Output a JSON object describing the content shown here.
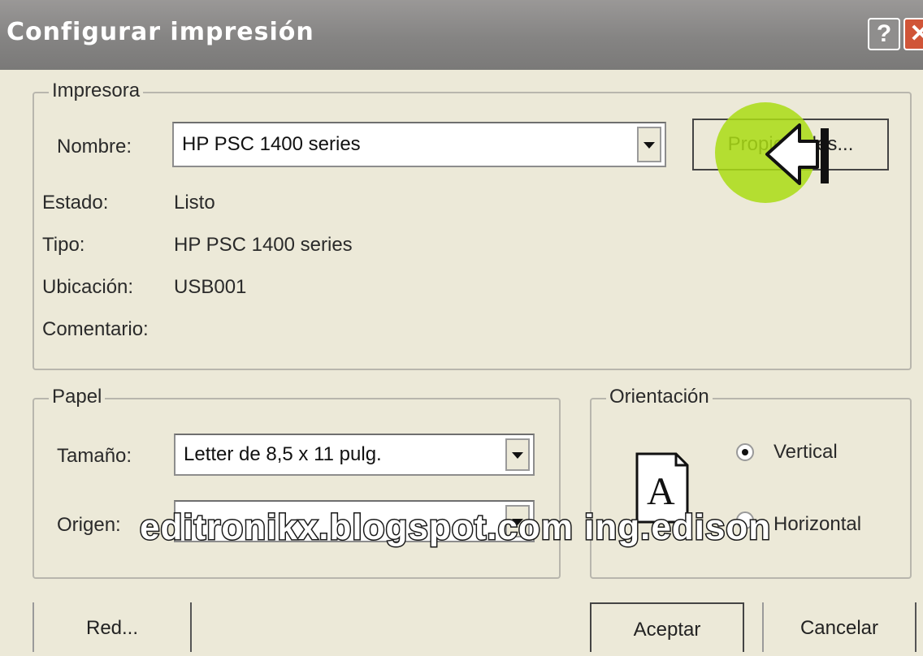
{
  "window": {
    "title": "Configurar impresión",
    "help_glyph": "?",
    "close_glyph": "✕"
  },
  "printer": {
    "group_label": "Impresora",
    "name_label": "Nombre:",
    "name_value": "HP PSC 1400 series",
    "properties_label": "Propiedades...",
    "status_label": "Estado:",
    "status_value": "Listo",
    "type_label": "Tipo:",
    "type_value": "HP PSC 1400 series",
    "location_label": "Ubicación:",
    "location_value": "USB001",
    "comment_label": "Comentario:",
    "comment_value": ""
  },
  "paper": {
    "group_label": "Papel",
    "size_label": "Tamaño:",
    "size_value": "Letter de 8,5 x 11 pulg.",
    "source_label": "Origen:",
    "source_value": ""
  },
  "orientation": {
    "group_label": "Orientación",
    "page_icon_letter": "A",
    "options": [
      {
        "label": "Vertical",
        "selected": true
      },
      {
        "label": "Horizontal",
        "selected": false
      }
    ]
  },
  "footer": {
    "network_label": "Red...",
    "ok_label": "Aceptar",
    "cancel_label": "Cancelar"
  },
  "overlay": {
    "watermark": "editronikx.blogspot.com ing.edison",
    "highlight_color": "#aadc14"
  }
}
